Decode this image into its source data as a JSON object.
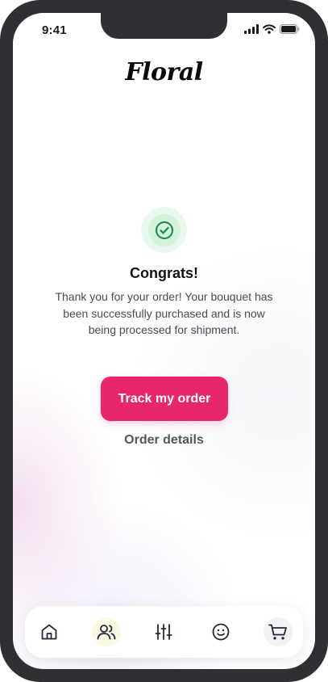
{
  "status_bar": {
    "time": "9:41",
    "icons": [
      "signal-icon",
      "wifi-icon",
      "battery-icon"
    ]
  },
  "app": {
    "logo_text": "Floral"
  },
  "confirmation": {
    "icon": "check-circle-icon",
    "title": "Congrats!",
    "message": "Thank you for your order! Your bouquet has been successfully purchased and is now being processed for shipment."
  },
  "actions": {
    "primary_label": "Track my order",
    "secondary_label": "Order details"
  },
  "bottom_nav": {
    "items": [
      {
        "icon": "home-icon"
      },
      {
        "icon": "people-icon"
      },
      {
        "icon": "sliders-icon"
      },
      {
        "icon": "smiley-icon"
      },
      {
        "icon": "cart-icon"
      }
    ]
  },
  "colors": {
    "accent": "#e8266c",
    "success": "#17894a",
    "success_bg": "#e9f8ed",
    "frame": "#2f3033"
  }
}
